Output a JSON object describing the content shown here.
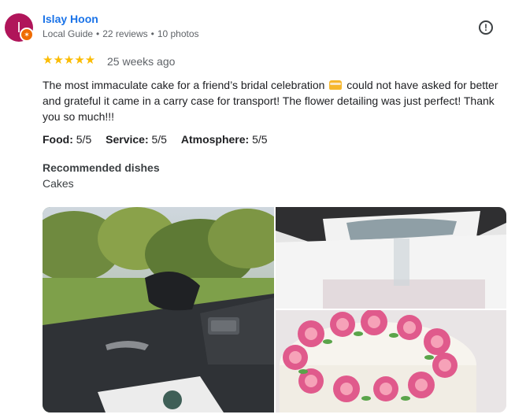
{
  "reviewer": {
    "initial": "I",
    "name": "Islay Hoon",
    "badge": "Local Guide",
    "reviews": "22 reviews",
    "photos": "10 photos"
  },
  "review": {
    "stars": "★★★★★",
    "rating_value": 5,
    "time": "25 weeks ago",
    "text_before_emoji": "The most immaculate cake for a friend’s bridal celebration",
    "text_after_emoji": "could not have asked for better and grateful it came in a carry case for transport! The flower detailing was just perfect! Thank you so much!!!",
    "ratings": [
      {
        "label": "Food:",
        "value": "5/5"
      },
      {
        "label": "Service:",
        "value": "5/5"
      },
      {
        "label": "Atmosphere:",
        "value": "5/5"
      }
    ],
    "recommended_title": "Recommended dishes",
    "recommended_value": "Cakes"
  },
  "icons": {
    "report": "report-icon",
    "local_guide_badge": "local-guide-badge-icon",
    "cake": "cake-emoji-icon"
  },
  "colors": {
    "name": "#1a73e8",
    "stars": "#fbbc04",
    "avatar": "#b0155a",
    "badge": "#ef6c00"
  }
}
